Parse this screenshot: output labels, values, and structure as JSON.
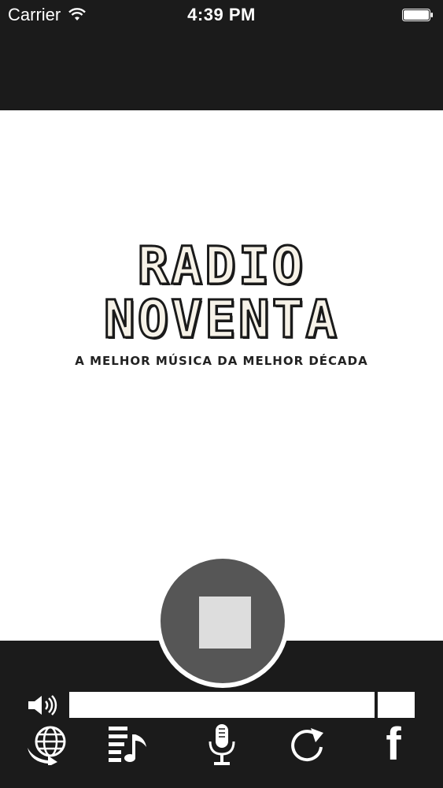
{
  "status_bar": {
    "carrier": "Carrier",
    "time": "4:39 PM",
    "wifi_icon": "wifi-icon",
    "battery_icon": "battery-icon"
  },
  "logo": {
    "line1": "RADIO",
    "line2": "NOVENTA",
    "tagline": "A MELHOR MÚSICA DA MELHOR DÉCADA"
  },
  "player": {
    "stop_icon": "stop-icon",
    "volume_icon": "speaker-icon"
  },
  "toolbar": {
    "items": [
      {
        "icon": "globe-icon"
      },
      {
        "icon": "playlist-icon"
      },
      {
        "icon": "microphone-icon"
      },
      {
        "icon": "refresh-icon"
      },
      {
        "icon": "facebook-icon",
        "glyph": "f"
      }
    ]
  },
  "colors": {
    "background": "#1b1b1b",
    "artwork_bg": "#ffffff",
    "stop_button": "#565656",
    "stop_square": "#dddddd"
  }
}
